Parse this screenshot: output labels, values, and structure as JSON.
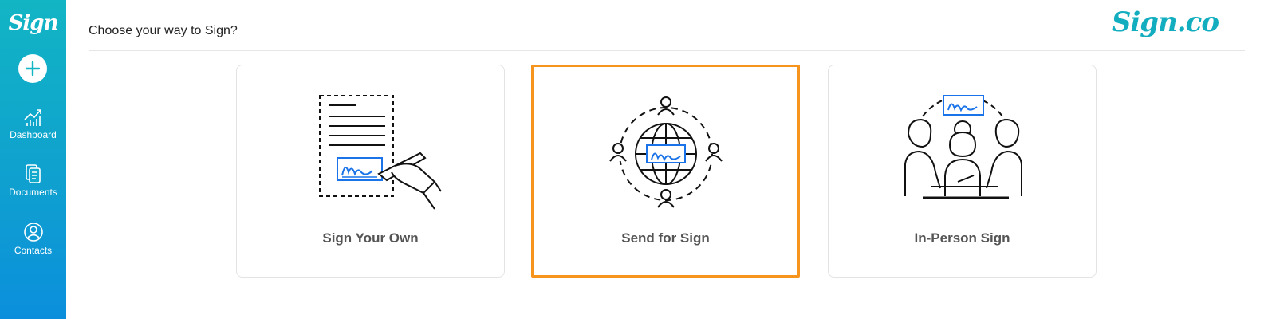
{
  "sidebar": {
    "logo": "Sign",
    "items": [
      {
        "label": "Dashboard",
        "icon": "chart-icon"
      },
      {
        "label": "Documents",
        "icon": "documents-icon"
      },
      {
        "label": "Contacts",
        "icon": "contact-icon"
      }
    ]
  },
  "header": {
    "title": "Choose your way to Sign?",
    "brand": "Sign.co"
  },
  "options": [
    {
      "label": "Sign Your Own",
      "illustration": "sign-own-icon",
      "selected": false
    },
    {
      "label": "Send for Sign",
      "illustration": "send-sign-icon",
      "selected": true
    },
    {
      "label": "In-Person Sign",
      "illustration": "in-person-icon",
      "selected": false
    }
  ],
  "colors": {
    "sidebar": "#12b5c4",
    "brand": "#12aebf",
    "selected_border": "#f7941d",
    "signature_blue": "#1a73e8"
  }
}
